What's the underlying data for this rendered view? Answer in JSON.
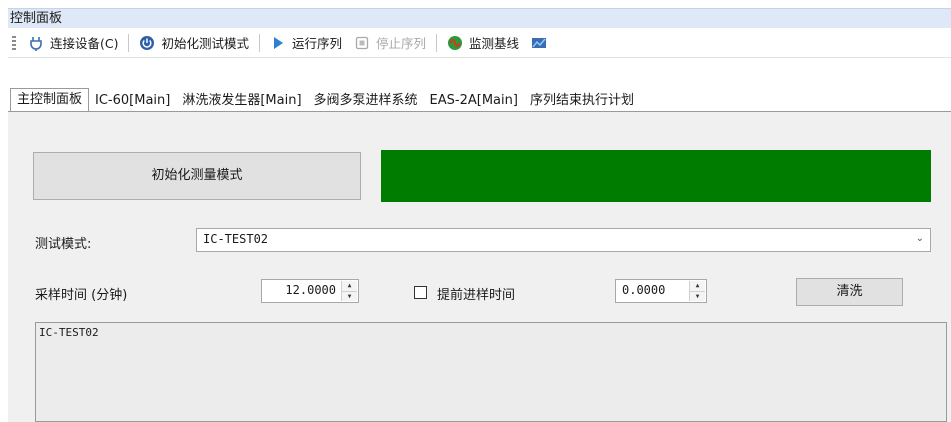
{
  "window": {
    "title": "控制面板"
  },
  "toolbar": {
    "items": [
      {
        "label": "连接设备(C)",
        "icon": "plug-icon",
        "enabled": true
      },
      {
        "label": "初始化测试模式",
        "icon": "power-icon",
        "enabled": true
      },
      {
        "label": "运行序列",
        "icon": "play-icon",
        "enabled": true
      },
      {
        "label": "停止序列",
        "icon": "stop-icon",
        "enabled": false
      },
      {
        "label": "监测基线",
        "icon": "monitor-baseline-icon",
        "enabled": true
      },
      {
        "label": "",
        "icon": "chart-icon",
        "enabled": true
      }
    ]
  },
  "tabs": [
    {
      "label": "主控制面板",
      "active": true
    },
    {
      "label": "IC-60[Main]",
      "active": false
    },
    {
      "label": "淋洗液发生器[Main]",
      "active": false
    },
    {
      "label": "多阀多泵进样系统",
      "active": false
    },
    {
      "label": "EAS-2A[Main]",
      "active": false
    },
    {
      "label": "序列结束执行计划",
      "active": false
    }
  ],
  "main": {
    "init_button": "初始化测量模式",
    "status_color": "#007c00",
    "mode_label": "测试模式:",
    "mode_value": "IC-TEST02",
    "sampling_label": "采样时间 (分钟)",
    "sampling_value": "12.0000",
    "advance_checkbox_label": "提前进样时间",
    "advance_checked": false,
    "advance_value": "0.0000",
    "wash_button": "清洗",
    "log_text": "IC-TEST02"
  },
  "colors": {
    "titlebar_bg": "#dfe8f6",
    "panel_bg": "#f0f0f0",
    "status_ok": "#007c00"
  }
}
